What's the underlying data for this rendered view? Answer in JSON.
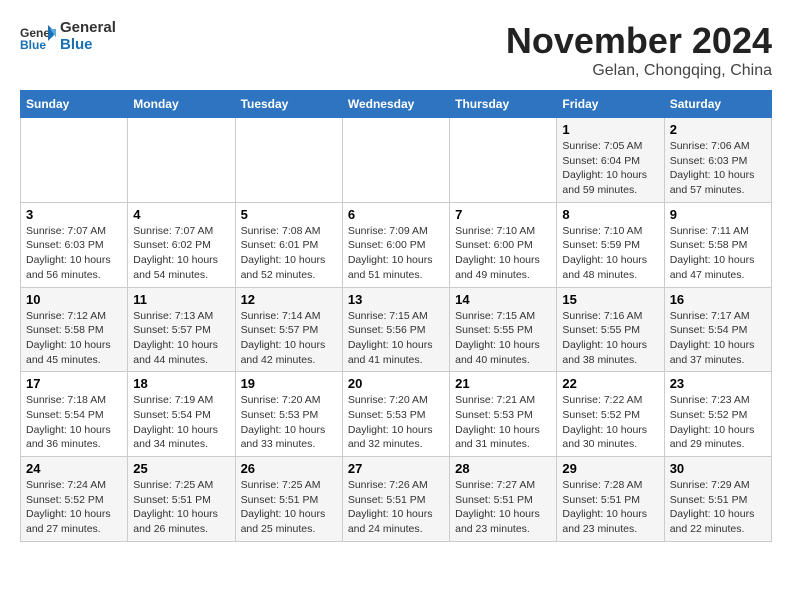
{
  "header": {
    "logo_general": "General",
    "logo_blue": "Blue",
    "month_year": "November 2024",
    "location": "Gelan, Chongqing, China"
  },
  "days_of_week": [
    "Sunday",
    "Monday",
    "Tuesday",
    "Wednesday",
    "Thursday",
    "Friday",
    "Saturday"
  ],
  "weeks": [
    [
      {
        "day": "",
        "info": ""
      },
      {
        "day": "",
        "info": ""
      },
      {
        "day": "",
        "info": ""
      },
      {
        "day": "",
        "info": ""
      },
      {
        "day": "",
        "info": ""
      },
      {
        "day": "1",
        "info": "Sunrise: 7:05 AM\nSunset: 6:04 PM\nDaylight: 10 hours and 59 minutes."
      },
      {
        "day": "2",
        "info": "Sunrise: 7:06 AM\nSunset: 6:03 PM\nDaylight: 10 hours and 57 minutes."
      }
    ],
    [
      {
        "day": "3",
        "info": "Sunrise: 7:07 AM\nSunset: 6:03 PM\nDaylight: 10 hours and 56 minutes."
      },
      {
        "day": "4",
        "info": "Sunrise: 7:07 AM\nSunset: 6:02 PM\nDaylight: 10 hours and 54 minutes."
      },
      {
        "day": "5",
        "info": "Sunrise: 7:08 AM\nSunset: 6:01 PM\nDaylight: 10 hours and 52 minutes."
      },
      {
        "day": "6",
        "info": "Sunrise: 7:09 AM\nSunset: 6:00 PM\nDaylight: 10 hours and 51 minutes."
      },
      {
        "day": "7",
        "info": "Sunrise: 7:10 AM\nSunset: 6:00 PM\nDaylight: 10 hours and 49 minutes."
      },
      {
        "day": "8",
        "info": "Sunrise: 7:10 AM\nSunset: 5:59 PM\nDaylight: 10 hours and 48 minutes."
      },
      {
        "day": "9",
        "info": "Sunrise: 7:11 AM\nSunset: 5:58 PM\nDaylight: 10 hours and 47 minutes."
      }
    ],
    [
      {
        "day": "10",
        "info": "Sunrise: 7:12 AM\nSunset: 5:58 PM\nDaylight: 10 hours and 45 minutes."
      },
      {
        "day": "11",
        "info": "Sunrise: 7:13 AM\nSunset: 5:57 PM\nDaylight: 10 hours and 44 minutes."
      },
      {
        "day": "12",
        "info": "Sunrise: 7:14 AM\nSunset: 5:57 PM\nDaylight: 10 hours and 42 minutes."
      },
      {
        "day": "13",
        "info": "Sunrise: 7:15 AM\nSunset: 5:56 PM\nDaylight: 10 hours and 41 minutes."
      },
      {
        "day": "14",
        "info": "Sunrise: 7:15 AM\nSunset: 5:55 PM\nDaylight: 10 hours and 40 minutes."
      },
      {
        "day": "15",
        "info": "Sunrise: 7:16 AM\nSunset: 5:55 PM\nDaylight: 10 hours and 38 minutes."
      },
      {
        "day": "16",
        "info": "Sunrise: 7:17 AM\nSunset: 5:54 PM\nDaylight: 10 hours and 37 minutes."
      }
    ],
    [
      {
        "day": "17",
        "info": "Sunrise: 7:18 AM\nSunset: 5:54 PM\nDaylight: 10 hours and 36 minutes."
      },
      {
        "day": "18",
        "info": "Sunrise: 7:19 AM\nSunset: 5:54 PM\nDaylight: 10 hours and 34 minutes."
      },
      {
        "day": "19",
        "info": "Sunrise: 7:20 AM\nSunset: 5:53 PM\nDaylight: 10 hours and 33 minutes."
      },
      {
        "day": "20",
        "info": "Sunrise: 7:20 AM\nSunset: 5:53 PM\nDaylight: 10 hours and 32 minutes."
      },
      {
        "day": "21",
        "info": "Sunrise: 7:21 AM\nSunset: 5:53 PM\nDaylight: 10 hours and 31 minutes."
      },
      {
        "day": "22",
        "info": "Sunrise: 7:22 AM\nSunset: 5:52 PM\nDaylight: 10 hours and 30 minutes."
      },
      {
        "day": "23",
        "info": "Sunrise: 7:23 AM\nSunset: 5:52 PM\nDaylight: 10 hours and 29 minutes."
      }
    ],
    [
      {
        "day": "24",
        "info": "Sunrise: 7:24 AM\nSunset: 5:52 PM\nDaylight: 10 hours and 27 minutes."
      },
      {
        "day": "25",
        "info": "Sunrise: 7:25 AM\nSunset: 5:51 PM\nDaylight: 10 hours and 26 minutes."
      },
      {
        "day": "26",
        "info": "Sunrise: 7:25 AM\nSunset: 5:51 PM\nDaylight: 10 hours and 25 minutes."
      },
      {
        "day": "27",
        "info": "Sunrise: 7:26 AM\nSunset: 5:51 PM\nDaylight: 10 hours and 24 minutes."
      },
      {
        "day": "28",
        "info": "Sunrise: 7:27 AM\nSunset: 5:51 PM\nDaylight: 10 hours and 23 minutes."
      },
      {
        "day": "29",
        "info": "Sunrise: 7:28 AM\nSunset: 5:51 PM\nDaylight: 10 hours and 23 minutes."
      },
      {
        "day": "30",
        "info": "Sunrise: 7:29 AM\nSunset: 5:51 PM\nDaylight: 10 hours and 22 minutes."
      }
    ]
  ]
}
